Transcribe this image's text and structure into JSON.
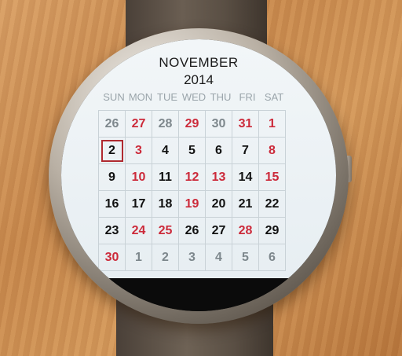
{
  "calendar": {
    "month": "NOVEMBER",
    "year": "2014",
    "weekdays": [
      "SUN",
      "MON",
      "TUE",
      "WED",
      "THU",
      "FRI",
      "SAT"
    ],
    "colors": {
      "holiday": "#cc2a3a",
      "today_border": "#b02a30",
      "other_month": "#7d878c",
      "text": "#111111"
    },
    "today": "2",
    "weeks": [
      [
        {
          "d": "26",
          "o": true
        },
        {
          "d": "27",
          "o": true,
          "r": true
        },
        {
          "d": "28",
          "o": true
        },
        {
          "d": "29",
          "o": true,
          "r": true
        },
        {
          "d": "30",
          "o": true
        },
        {
          "d": "31",
          "o": true,
          "r": true
        },
        {
          "d": "1",
          "r": true
        }
      ],
      [
        {
          "d": "2",
          "t": true
        },
        {
          "d": "3",
          "r": true
        },
        {
          "d": "4"
        },
        {
          "d": "5"
        },
        {
          "d": "6"
        },
        {
          "d": "7"
        },
        {
          "d": "8",
          "r": true
        }
      ],
      [
        {
          "d": "9"
        },
        {
          "d": "10",
          "r": true
        },
        {
          "d": "11"
        },
        {
          "d": "12",
          "r": true
        },
        {
          "d": "13",
          "r": true
        },
        {
          "d": "14"
        },
        {
          "d": "15",
          "r": true
        }
      ],
      [
        {
          "d": "16"
        },
        {
          "d": "17"
        },
        {
          "d": "18"
        },
        {
          "d": "19",
          "r": true
        },
        {
          "d": "20"
        },
        {
          "d": "21"
        },
        {
          "d": "22"
        }
      ],
      [
        {
          "d": "23"
        },
        {
          "d": "24",
          "r": true
        },
        {
          "d": "25",
          "r": true
        },
        {
          "d": "26"
        },
        {
          "d": "27"
        },
        {
          "d": "28",
          "r": true
        },
        {
          "d": "29"
        }
      ],
      [
        {
          "d": "30",
          "r": true
        },
        {
          "d": "1",
          "o": true
        },
        {
          "d": "2",
          "o": true
        },
        {
          "d": "3",
          "o": true
        },
        {
          "d": "4",
          "o": true
        },
        {
          "d": "5",
          "o": true
        },
        {
          "d": "6",
          "o": true
        }
      ]
    ]
  }
}
